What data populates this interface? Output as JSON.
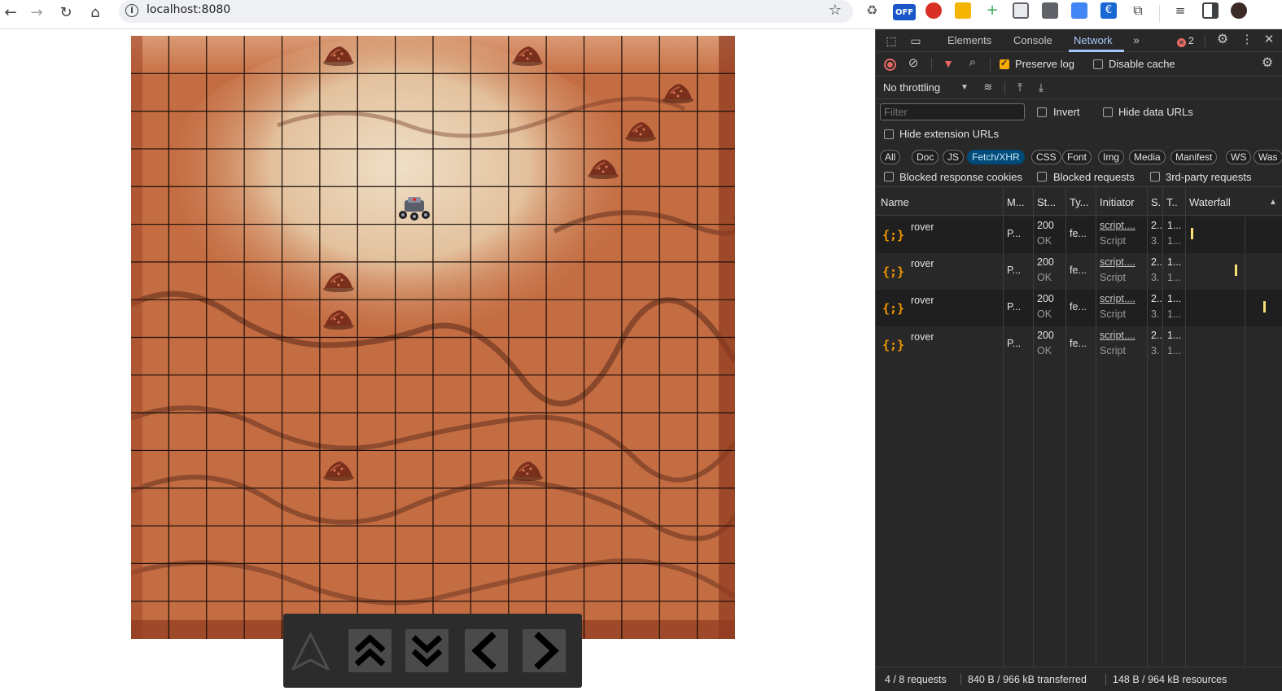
{
  "browser": {
    "url": "localhost:8080",
    "back_icon": "arrow-left-icon",
    "forward_icon": "arrow-right-icon",
    "reload_icon": "reload-icon",
    "home_icon": "home-icon",
    "bookmark_icon": "star-icon",
    "extension_badge_text": "OFF"
  },
  "game": {
    "grid_rows": 16,
    "grid_cols": 16,
    "terrain_colors": {
      "dark": "#b4532e",
      "mid": "#c86f45",
      "light": "#e2c2a0",
      "sand": "#ecdcc2"
    },
    "controls": {
      "forward_icon": "arrow-up-outline-icon",
      "double_up_icon": "chevrons-up-icon",
      "double_down_icon": "chevrons-down-icon",
      "left_icon": "chevron-left-icon",
      "right_icon": "chevron-right-icon"
    }
  },
  "devtools": {
    "tabs": [
      "Elements",
      "Console",
      "Network"
    ],
    "active_tab": "Network",
    "error_count": "2",
    "toolbar": {
      "preserve_log": "Preserve log",
      "disable_cache": "Disable cache",
      "throttling": "No throttling"
    },
    "filter": {
      "placeholder": "Filter",
      "invert": "Invert",
      "hide_data_urls": "Hide data URLs",
      "hide_extension_urls": "Hide extension URLs"
    },
    "type_filters": [
      "All",
      "Doc",
      "JS",
      "Fetch/XHR",
      "CSS",
      "Font",
      "Img",
      "Media",
      "Manifest",
      "WS",
      "Was"
    ],
    "active_type_filter": "Fetch/XHR",
    "extra_filters": {
      "blocked_cookies": "Blocked response cookies",
      "blocked_requests": "Blocked requests",
      "third_party": "3rd-party requests"
    },
    "columns": [
      "Name",
      "M...",
      "St...",
      "Ty...",
      "Initiator",
      "S.",
      "T..",
      "Waterfall"
    ],
    "requests": [
      {
        "name": "rover",
        "method": "P...",
        "status": "200",
        "status_text": "OK",
        "type": "fe...",
        "initiator": "script....",
        "initiator_type": "Script",
        "size": "2..",
        "size2": "3.",
        "time": "1...",
        "time2": "1..."
      },
      {
        "name": "rover",
        "method": "P...",
        "status": "200",
        "status_text": "OK",
        "type": "fe...",
        "initiator": "script....",
        "initiator_type": "Script",
        "size": "2..",
        "size2": "3.",
        "time": "1...",
        "time2": "1..."
      },
      {
        "name": "rover",
        "method": "P...",
        "status": "200",
        "status_text": "OK",
        "type": "fe...",
        "initiator": "script....",
        "initiator_type": "Script",
        "size": "2..",
        "size2": "3.",
        "time": "1...",
        "time2": "1..."
      },
      {
        "name": "rover",
        "method": "P...",
        "status": "200",
        "status_text": "OK",
        "type": "fe...",
        "initiator": "script....",
        "initiator_type": "Script",
        "size": "2..",
        "size2": "3.",
        "time": "1...",
        "time2": "1..."
      }
    ],
    "status": {
      "requests": "4 / 8 requests",
      "transferred": "840 B / 966 kB transferred",
      "resources": "148 B / 964 kB resources"
    },
    "accent_color": "#a8c7fa"
  }
}
